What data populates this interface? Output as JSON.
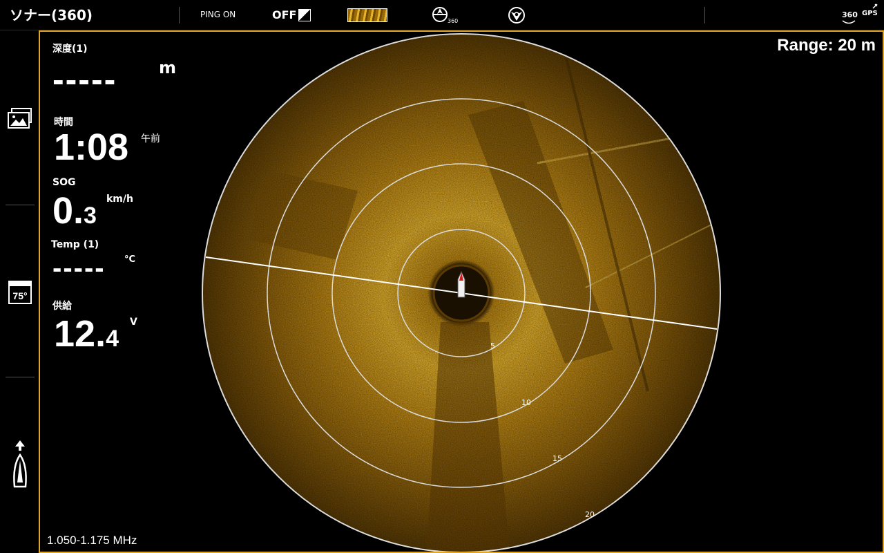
{
  "topbar": {
    "title": "ソナー(360)",
    "ping_status": "PING ON",
    "off_label": "OFF",
    "icon_360_label": "360",
    "gps_label": "GPS",
    "status_360_label": "360"
  },
  "sidebar": {
    "items": [
      {
        "name": "views-icon"
      },
      {
        "name": "water-temp-icon",
        "label": "75°"
      },
      {
        "name": "boat-heading-icon"
      }
    ]
  },
  "readouts": {
    "depth": {
      "label": "深度(1)",
      "value": "-----",
      "unit": "m"
    },
    "time": {
      "label": "時間",
      "value": "1:08",
      "unit": "午前"
    },
    "sog": {
      "label": "SOG",
      "value_int": "0.",
      "value_dec": "3",
      "unit": "km/h"
    },
    "temp": {
      "label": "Temp (1)",
      "value": "-----",
      "unit": "°C"
    },
    "supply": {
      "label": "供給",
      "value_int": "12.",
      "value_dec": "4",
      "unit": "V"
    }
  },
  "sonar": {
    "range_label": "Range: 20 m",
    "frequency": "1.050-1.175 MHz",
    "range_rings": [
      "5",
      "10",
      "15",
      "20"
    ],
    "colors": {
      "accent": "#e0a628",
      "sonar_bright": "#e8b22c",
      "sonar_dark": "#4a3004"
    }
  }
}
